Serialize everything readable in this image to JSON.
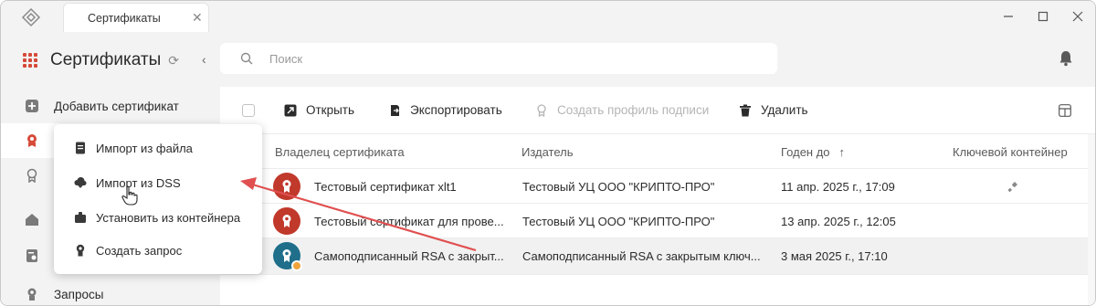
{
  "titlebar": {
    "tab_label": "Сертификаты",
    "tab_close_icon": "close-icon"
  },
  "sidebar": {
    "title": "Сертификаты",
    "items": [
      {
        "label": "Добавить сертификат",
        "icon": "plus-square-icon"
      },
      {
        "label": "",
        "icon": "certificate-icon",
        "active": true
      },
      {
        "label": "",
        "icon": "certificate-outline-icon"
      },
      {
        "label": "",
        "icon": "home-icon"
      },
      {
        "label": "",
        "icon": "document-cert-icon"
      },
      {
        "label": "Запросы",
        "icon": "request-icon"
      }
    ]
  },
  "search": {
    "placeholder": "Поиск"
  },
  "toolbar": {
    "open_label": "Открыть",
    "export_label": "Экспортировать",
    "create_profile_label": "Создать профиль подписи",
    "delete_label": "Удалить"
  },
  "table": {
    "columns": [
      "Владелец сертификата",
      "Издатель",
      "Годен до",
      "Ключевой контейнер"
    ],
    "sort_indicator": "↑",
    "rows": [
      {
        "owner": "Тестовый сертификат xlt1",
        "issuer": "Тестовый УЦ ООО \"КРИПТО-ПРО\"",
        "valid_to": "11 апр. 2025 г., 17:09",
        "has_key": true,
        "avatar_color": "#c0392b",
        "badge": false
      },
      {
        "owner": "Тестовый сертификат для прове...",
        "issuer": "Тестовый УЦ ООО \"КРИПТО-ПРО\"",
        "valid_to": "13 апр. 2025 г., 12:05",
        "has_key": false,
        "avatar_color": "#c0392b",
        "badge": false
      },
      {
        "owner": "Самоподписанный RSA с закрыт...",
        "issuer": "Самоподписанный RSA с закрытым ключ...",
        "valid_to": "3 мая 2025 г., 17:10",
        "has_key": false,
        "avatar_color": "#1f6f8b",
        "badge": true
      }
    ]
  },
  "popup_menu": {
    "items": [
      {
        "label": "Импорт из файла",
        "icon": "file-icon"
      },
      {
        "label": "Импорт из DSS",
        "icon": "cloud-download-icon"
      },
      {
        "label": "Установить из контейнера",
        "icon": "container-icon"
      },
      {
        "label": "Создать запрос",
        "icon": "request-icon"
      }
    ]
  },
  "colors": {
    "accent_red": "#d64a3a",
    "annotation_arrow": "#e05050",
    "avatar_red": "#c0392b",
    "avatar_teal": "#1f6f8b",
    "badge_orange": "#f0a33a"
  }
}
